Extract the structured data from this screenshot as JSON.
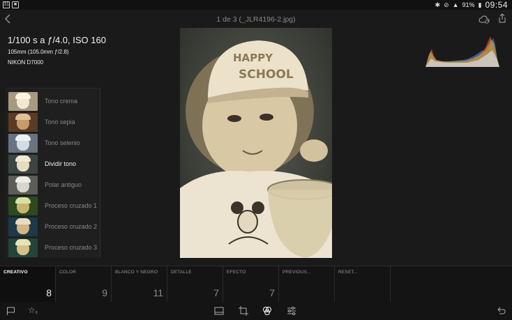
{
  "status_bar": {
    "notif_icons": [
      "31",
      "■"
    ],
    "battery": "91%",
    "time": "09:54"
  },
  "header": {
    "title": "1 de 3 (_JLR4196-2.jpg)"
  },
  "exif": {
    "main": "1/100 s a ƒ/4.0, ISO 160",
    "lens": "105mm (105.0mm ƒ/2.8)",
    "camera": "NIKON D7000"
  },
  "presets": [
    {
      "label": "Tono crema",
      "tint": "#e8dcc4",
      "active": false
    },
    {
      "label": "Tono sepia",
      "tint": "#b48a62",
      "active": false
    },
    {
      "label": "Tono selenio",
      "tint": "#b9c8d6",
      "active": false
    },
    {
      "label": "Dividir tono",
      "tint": "#d8ceb2",
      "active": true
    },
    {
      "label": "Polar antiguo",
      "tint": "#cfcfc5",
      "active": false
    },
    {
      "label": "Proceso cruzado 1",
      "tint": "#4e7a3a",
      "active": false
    },
    {
      "label": "Proceso cruzado 2",
      "tint": "#3f7a86",
      "active": false
    },
    {
      "label": "Proceso cruzado 3",
      "tint": "#5e8a6a",
      "active": false
    }
  ],
  "tabs": [
    {
      "label": "CREATIVO",
      "count": "8",
      "active": true
    },
    {
      "label": "COLOR",
      "count": "9",
      "active": false
    },
    {
      "label": "BLANCO Y NEGRO",
      "count": "11",
      "active": false
    },
    {
      "label": "DETALLE",
      "count": "7",
      "active": false
    },
    {
      "label": "EFECTO",
      "count": "7",
      "active": false
    },
    {
      "label": "PREVIOUS...",
      "count": "",
      "active": false
    },
    {
      "label": "RESET...",
      "count": "",
      "active": false
    }
  ],
  "bottom_bar": {
    "star_count": "0",
    "icons": [
      "flag-icon",
      "star-icon",
      "filmstrip-icon",
      "crop-icon",
      "presets-icon",
      "adjust-icon",
      "undo-icon"
    ]
  },
  "colors": {
    "background": "#1a1a1a",
    "panel": "#1f1f1f",
    "tab_bar": "#141414",
    "photo_tone": "#e8dcc0"
  }
}
